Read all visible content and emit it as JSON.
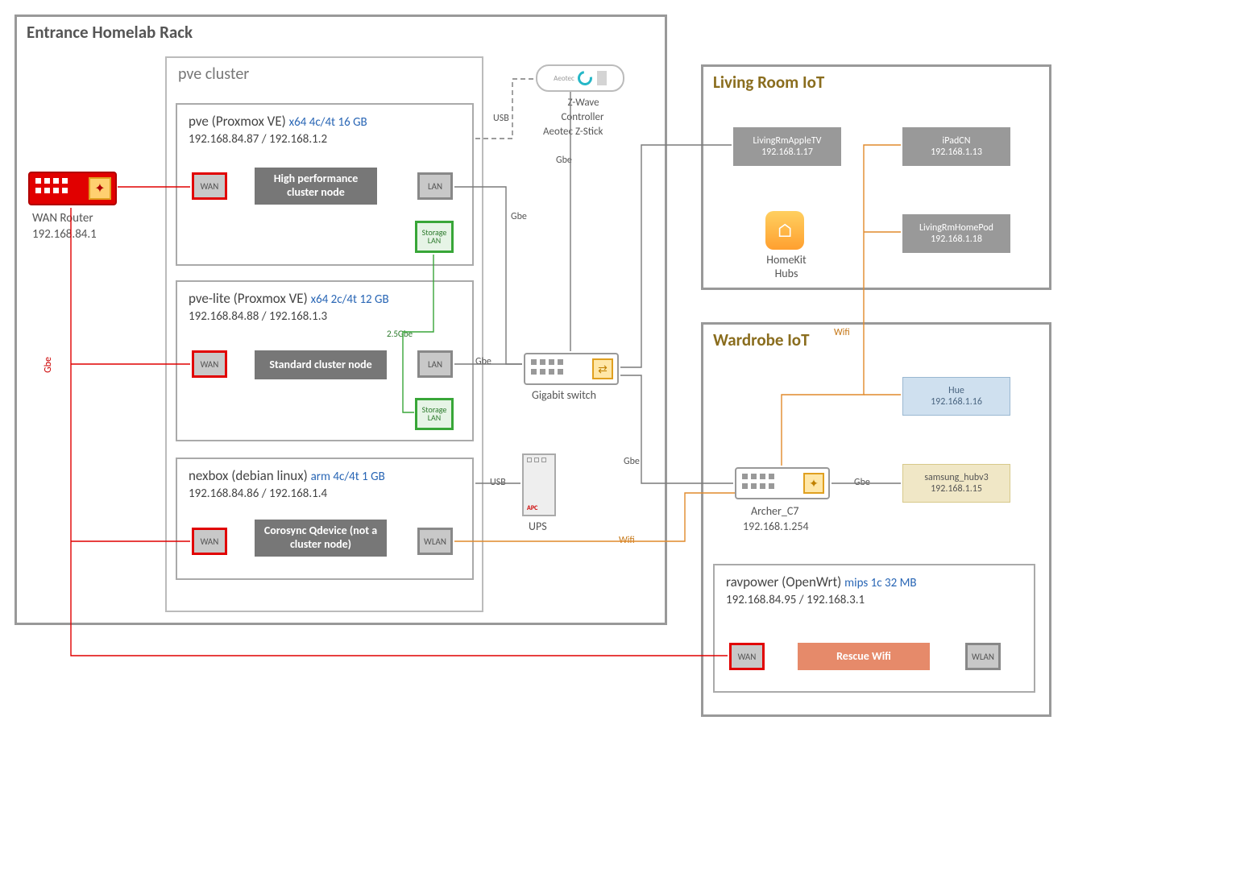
{
  "entrance_rack": {
    "title": "Entrance Homelab Rack"
  },
  "wan_router": {
    "label": "WAN Router",
    "ip": "192.168.84.1"
  },
  "cluster": {
    "title": "pve cluster"
  },
  "pve": {
    "name": "pve (Proxmox VE)",
    "spec": "x64 4c/4t 16 GB",
    "ips": "192.168.84.87 / 192.168.1.2",
    "role": "High performance cluster node"
  },
  "pvelite": {
    "name": "pve-lite (Proxmox VE)",
    "spec": "x64 2c/4t 12 GB",
    "ips": "192.168.84.88 / 192.168.1.3",
    "role": "Standard cluster node"
  },
  "nexbox": {
    "name": "nexbox (debian linux)",
    "spec": "arm 4c/4t 1 GB",
    "ips": "192.168.84.86 / 192.168.1.4",
    "role": "Corosync Qdevice (not a cluster node)"
  },
  "ports": {
    "wan": "WAN",
    "lan": "LAN",
    "wlan": "WLAN",
    "storage": "Storage LAN",
    "storage2": "Storage LAN"
  },
  "zwave": {
    "line1": "Z-Wave",
    "line2": "Controller",
    "line3": "Aeotec Z-Stick"
  },
  "switch": {
    "label": "Gigabit switch"
  },
  "ups": {
    "label": "UPS"
  },
  "living": {
    "title": "Living Room IoT",
    "homekit": "HomeKit Hubs"
  },
  "dev": {
    "ipad": {
      "name": "iPadCN",
      "ip": "192.168.1.13"
    },
    "homepod": {
      "name": "LivingRmHomePod",
      "ip": "192.168.1.18"
    },
    "appletv": {
      "name": "LivingRmAppleTV",
      "ip": "192.168.1.17"
    },
    "hue": {
      "name": "Hue",
      "ip": "192.168.1.16"
    },
    "st": {
      "name": "samsung_hubv3",
      "ip": "192.168.1.15"
    }
  },
  "wardrobe": {
    "title": "Wardrobe IoT"
  },
  "archer": {
    "name": "Archer_C7",
    "ip": "192.168.1.254"
  },
  "ravpower": {
    "name": "ravpower (OpenWrt)",
    "spec": "mips 1c 32 MB",
    "ips": "192.168.84.95 / 192.168.3.1",
    "role": "Rescue Wifi"
  },
  "link": {
    "gbe": "Gbe",
    "usb": "USB",
    "wifi": "Wifi",
    "sbe": "2.5Gbe"
  }
}
